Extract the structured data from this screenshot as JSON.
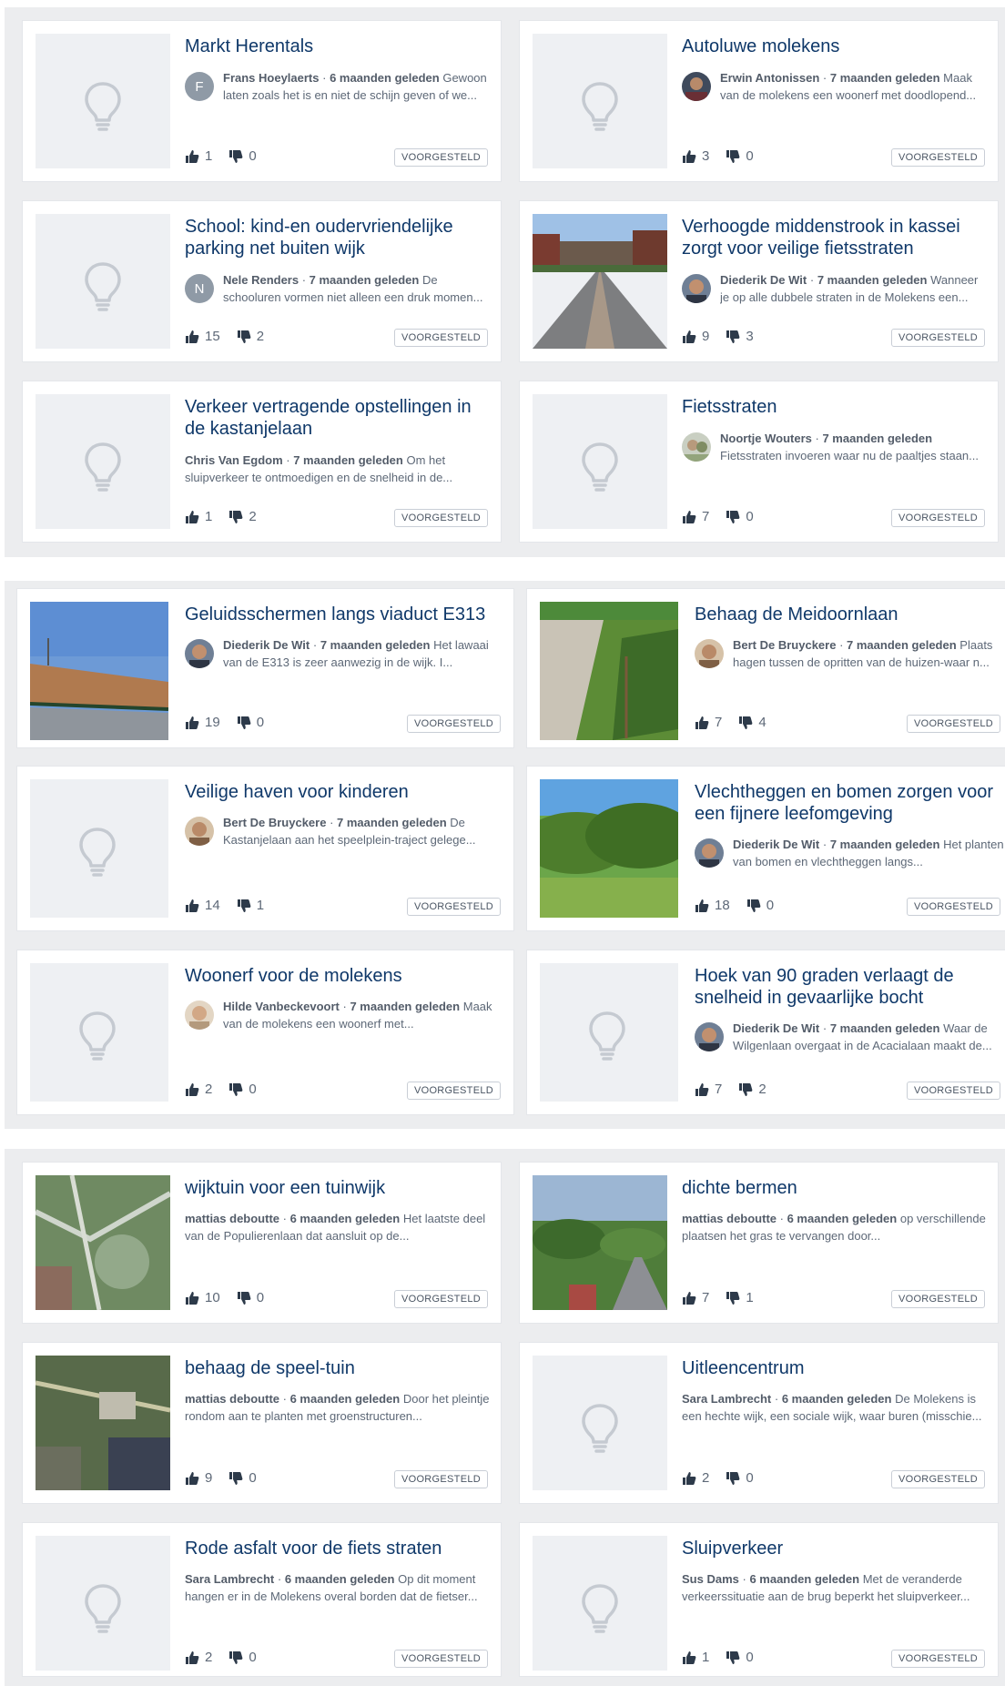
{
  "status_label": "VOORGESTELD",
  "sections": [
    {
      "cards": [
        {
          "title": "Markt Herentals",
          "author": "Frans Hoeylaerts",
          "time": "6 maanden geleden",
          "excerpt": "Gewoon laten zoals het is en niet de schijn geven of we...",
          "likes": "1",
          "dislikes": "0",
          "avatar_letter": "F"
        },
        {
          "title": "Autoluwe molekens",
          "author": "Erwin Antonissen",
          "time": "7 maanden geleden",
          "excerpt": "Maak van de molekens een woonerf met doodlopend...",
          "likes": "3",
          "dislikes": "0"
        },
        {
          "title": "School: kind-en oudervriendelijke parking net buiten wijk",
          "author": "Nele Renders",
          "time": "7 maanden geleden",
          "excerpt": "De schooluren vormen niet alleen een druk momen...",
          "likes": "15",
          "dislikes": "2",
          "avatar_letter": "N"
        },
        {
          "title": "Verhoogde middenstrook in kassei zorgt voor veilige fietsstraten",
          "author": "Diederik De Wit",
          "time": "7 maanden geleden",
          "excerpt": "Wanneer je op alle dubbele straten in de Molekens een...",
          "likes": "9",
          "dislikes": "3"
        },
        {
          "title": "Verkeer vertragende opstellingen in de kastanjelaan",
          "author": "Chris Van Egdom",
          "time": "7 maanden geleden",
          "excerpt": "Om het sluipverkeer te ontmoedigen en de snelheid in de...",
          "likes": "1",
          "dislikes": "2"
        },
        {
          "title": "Fietsstraten",
          "author": "Noortje Wouters",
          "time": "7 maanden geleden",
          "excerpt": "Fietsstraten invoeren waar nu de paaltjes staan...",
          "likes": "7",
          "dislikes": "0"
        }
      ]
    },
    {
      "cards": [
        {
          "title": "Geluidsschermen langs viaduct E313",
          "author": "Diederik De Wit",
          "time": "7 maanden geleden",
          "excerpt": "Het lawaai van de E313 is zeer aanwezig in de wijk. I...",
          "likes": "19",
          "dislikes": "0"
        },
        {
          "title": "Behaag de Meidoornlaan",
          "author": "Bert De Bruyckere",
          "time": "7 maanden geleden",
          "excerpt": "Plaats hagen tussen de opritten van de huizen-waar n...",
          "likes": "7",
          "dislikes": "4"
        },
        {
          "title": "Veilige haven voor kinderen",
          "author": "Bert De Bruyckere",
          "time": "7 maanden geleden",
          "excerpt": "De Kastanjelaan aan het speelplein-traject gelege...",
          "likes": "14",
          "dislikes": "1"
        },
        {
          "title": "Vlechtheggen en bomen zorgen voor een fijnere leefomgeving",
          "author": "Diederik De Wit",
          "time": "7 maanden geleden",
          "excerpt": "Het planten van bomen en vlechtheggen langs...",
          "likes": "18",
          "dislikes": "0"
        },
        {
          "title": "Woonerf voor de molekens",
          "author": "Hilde Vanbeckevoort",
          "time": "7 maanden geleden",
          "excerpt": "Maak van de molekens een woonerf met...",
          "likes": "2",
          "dislikes": "0"
        },
        {
          "title": "Hoek van 90 graden verlaagt de snelheid in gevaarlijke bocht",
          "author": "Diederik De Wit",
          "time": "7 maanden geleden",
          "excerpt": "Waar de Wilgenlaan overgaat in de Acacialaan maakt de...",
          "likes": "7",
          "dislikes": "2"
        }
      ]
    },
    {
      "cards": [
        {
          "title": "wijktuin voor een tuinwijk",
          "author": "mattias deboutte",
          "time": "6 maanden geleden",
          "excerpt": "Het laatste deel van de Populierenlaan dat aansluit op de...",
          "likes": "10",
          "dislikes": "0"
        },
        {
          "title": "dichte bermen",
          "author": "mattias deboutte",
          "time": "6 maanden geleden",
          "excerpt": "op verschillende plaatsen het gras te vervangen door...",
          "likes": "7",
          "dislikes": "1"
        },
        {
          "title": "behaag de speel-tuin",
          "author": "mattias deboutte",
          "time": "6 maanden geleden",
          "excerpt": "Door het pleintje rondom aan te planten met groenstructuren...",
          "likes": "9",
          "dislikes": "0"
        },
        {
          "title": "Uitleencentrum",
          "author": "Sara Lambrecht",
          "time": "6 maanden geleden",
          "excerpt": "De Molekens is een hechte wijk, een sociale wijk, waar buren (misschie...",
          "likes": "2",
          "dislikes": "0"
        },
        {
          "title": "Rode asfalt voor de fiets straten",
          "author": "Sara Lambrecht",
          "time": "6 maanden geleden",
          "excerpt": "Op dit moment hangen er in de Molekens overal borden dat de fietser...",
          "likes": "2",
          "dislikes": "0"
        },
        {
          "title": "Sluipverkeer",
          "author": "Sus Dams",
          "time": "6 maanden geleden",
          "excerpt": "Met de veranderde verkeerssituatie aan de brug beperkt het sluipverkeer...",
          "likes": "1",
          "dislikes": "0"
        }
      ]
    }
  ]
}
